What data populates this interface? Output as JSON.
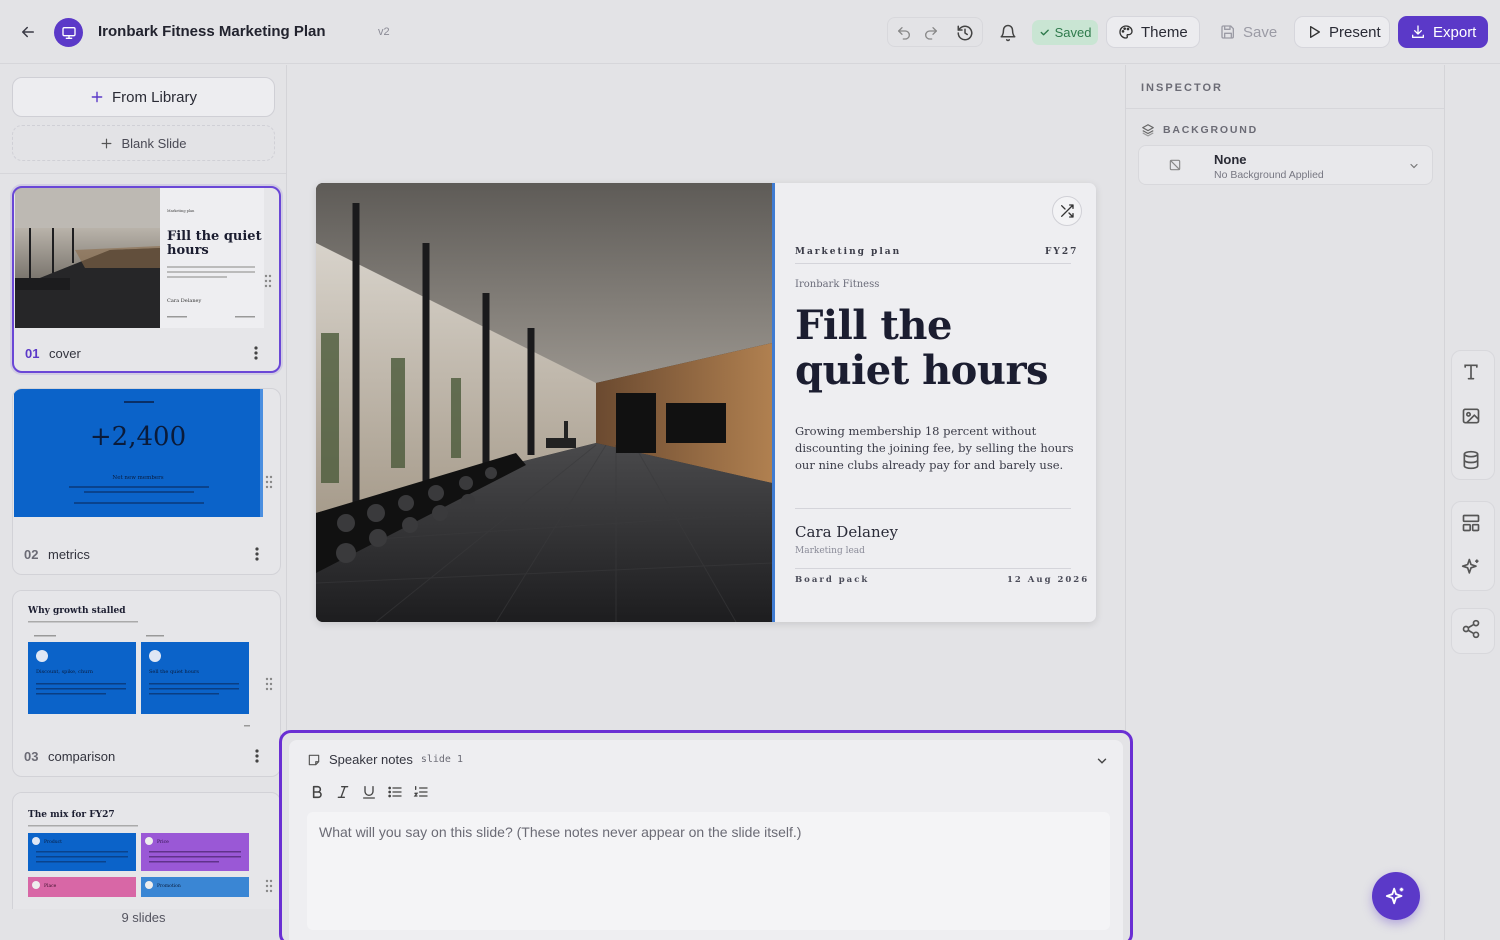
{
  "header": {
    "title": "Ironbark Fitness Marketing Plan",
    "version": "v2",
    "status": "Saved",
    "theme_label": "Theme",
    "save_label": "Save",
    "present_label": "Present",
    "export_label": "Export",
    "accent": "#5b39c8"
  },
  "sidebar": {
    "from_library": "From Library",
    "blank_slide": "Blank Slide",
    "slide_count": "9 slides",
    "slides": [
      {
        "num": "01",
        "name": "cover",
        "title": "Fill the quiet hours",
        "kicker": "Marketing plan",
        "author": "Cara Delaney"
      },
      {
        "num": "02",
        "name": "metrics",
        "stat": "+2,400",
        "caption": "Net new members"
      },
      {
        "num": "03",
        "name": "comparison",
        "title": "Why growth stalled",
        "a": "Discount, spike, churn",
        "b": "Sell the quiet hours"
      },
      {
        "num": "04",
        "name": "mix",
        "title": "The mix for FY27",
        "tiles": [
          "Product",
          "Price",
          "Place",
          "Promotion"
        ]
      }
    ]
  },
  "slide": {
    "kicker": "Marketing plan",
    "fy": "FY27",
    "brand": "Ironbark Fitness",
    "headline": "Fill the quiet hours",
    "body": "Growing membership 18 percent without discounting the joining fee, by selling the hours our nine clubs already pay for and barely use.",
    "author": "Cara Delaney",
    "role": "Marketing lead",
    "footer_left": "Board pack",
    "footer_right": "12 Aug 2026",
    "accent_line": "#3f7bd1"
  },
  "inspector": {
    "title": "INSPECTOR",
    "section": "BACKGROUND",
    "bg_value": "None",
    "bg_sub": "No Background Applied"
  },
  "notes": {
    "title": "Speaker notes",
    "slide_ref": "slide 1",
    "placeholder": "What will you say on this slide? (These notes never appear on the slide itself.)"
  }
}
